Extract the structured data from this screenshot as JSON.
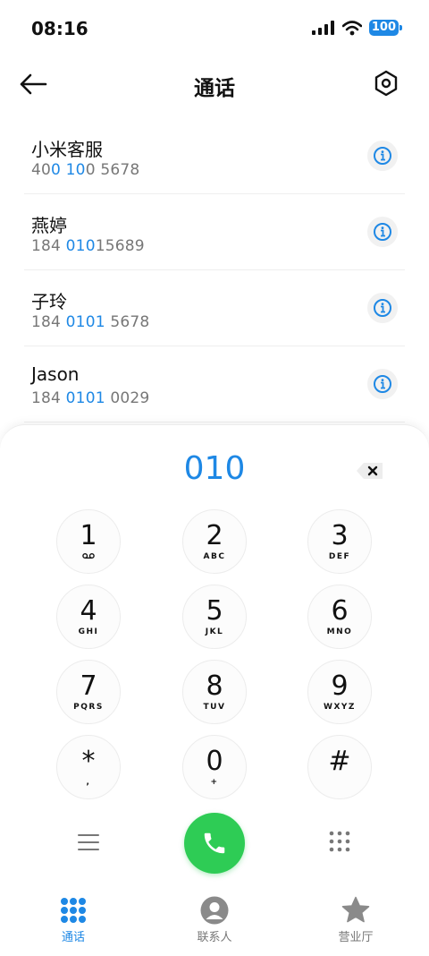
{
  "status_bar": {
    "time": "08:16",
    "battery": "100"
  },
  "header": {
    "title": "通话"
  },
  "contacts": [
    {
      "name": "小米客服",
      "number_parts": [
        "40",
        "0 10",
        "0 5678"
      ]
    },
    {
      "name": "燕婷",
      "number_parts": [
        "184 ",
        "010",
        "15689"
      ]
    },
    {
      "name": "子玲",
      "number_parts": [
        "184 ",
        "0101",
        " 5678"
      ]
    },
    {
      "name": "Jason",
      "number_parts": [
        "184 ",
        "0101",
        " 0029"
      ]
    }
  ],
  "dialpad": {
    "dialed_number": "010",
    "keys": [
      {
        "digit": "1",
        "letters": ""
      },
      {
        "digit": "2",
        "letters": "ABC"
      },
      {
        "digit": "3",
        "letters": "DEF"
      },
      {
        "digit": "4",
        "letters": "GHI"
      },
      {
        "digit": "5",
        "letters": "JKL"
      },
      {
        "digit": "6",
        "letters": "MNO"
      },
      {
        "digit": "7",
        "letters": "PQRS"
      },
      {
        "digit": "8",
        "letters": "TUV"
      },
      {
        "digit": "9",
        "letters": "WXYZ"
      },
      {
        "digit": "*",
        "letters": ","
      },
      {
        "digit": "0",
        "letters": "+"
      },
      {
        "digit": "#",
        "letters": ""
      }
    ]
  },
  "tabs": [
    {
      "label": "通话",
      "icon": "dialpad-grid-icon",
      "active": true
    },
    {
      "label": "联系人",
      "icon": "person-icon",
      "active": false
    },
    {
      "label": "营业厅",
      "icon": "star-icon",
      "active": false
    }
  ],
  "colors": {
    "accent": "#1e88e5",
    "call": "#2ecc55"
  }
}
